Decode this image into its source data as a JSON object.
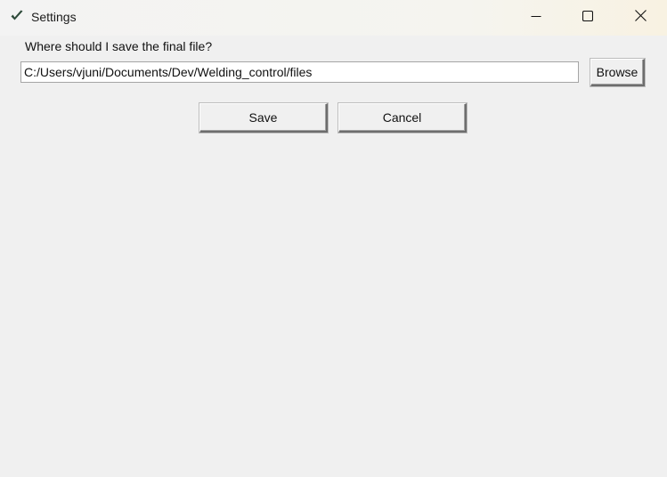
{
  "window": {
    "title": "Settings",
    "controls": {
      "minimize_icon": "minimize-icon",
      "maximize_icon": "maximize-icon",
      "close_icon": "close-icon"
    }
  },
  "form": {
    "prompt": "Where should I save the final file?",
    "path_value": "C:/Users/vjuni/Documents/Dev/Welding_control/files",
    "browse_label": "Browse",
    "save_label": "Save",
    "cancel_label": "Cancel"
  },
  "colors": {
    "window_background": "#f0f0f0",
    "checkmark_icon": "#2e4a3a"
  }
}
